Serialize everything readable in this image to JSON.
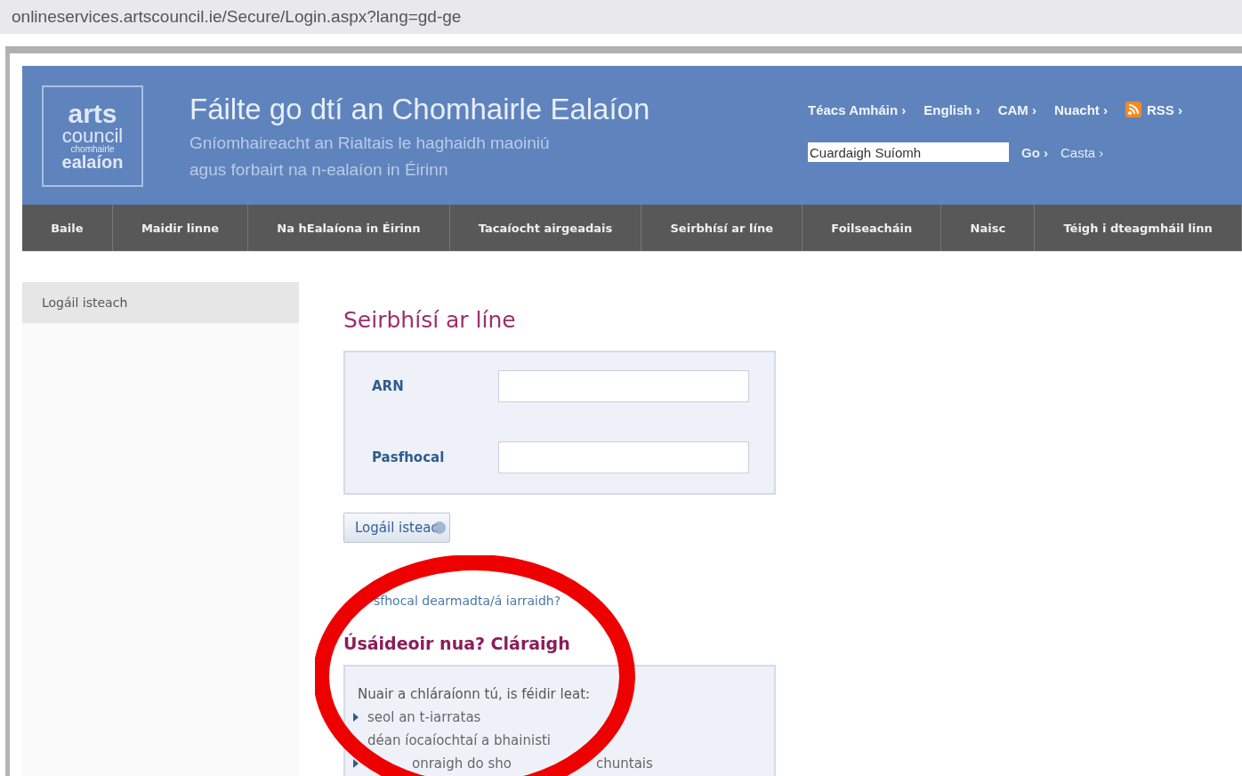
{
  "address_bar": {
    "url": "onlineservices.artscouncil.ie/Secure/Login.aspx?lang=gd-ge"
  },
  "header": {
    "logo": [
      "arts",
      "council",
      "chomhairle",
      "ealaíon"
    ],
    "title": "Fáilte go dtí an Chomhairle Ealaíon",
    "subtitle": [
      "Gníomhaireacht an Rialtais le haghaidh maoiniú",
      "agus forbairt na n-ealaíon in Éirinn"
    ],
    "links": [
      {
        "label": "Téacs Amháin ›",
        "kind": "text"
      },
      {
        "label": "English ›",
        "kind": "text"
      },
      {
        "label": "CAM ›",
        "kind": "text"
      },
      {
        "label": "Nuacht ›",
        "kind": "text"
      },
      {
        "label": "RSS ›",
        "kind": "rss"
      }
    ],
    "search": {
      "value": "Cuardaigh Suíomh",
      "go": "Go ›",
      "advanced": "Casta ›"
    }
  },
  "nav": [
    "Baile",
    "Maidir linne",
    "Na hEalaíona in Éirinn",
    "Tacaíocht airgeadais",
    "Seirbhísí ar líne",
    "Foilseacháin",
    "Naisc",
    "Téigh i dteagmháil linn"
  ],
  "sidebar": {
    "items": [
      {
        "label": "Logáil isteach",
        "selected": true
      }
    ]
  },
  "main": {
    "title": "Seirbhísí ar líne",
    "fields": [
      {
        "label": "ARN"
      },
      {
        "label": "Pasfhocal"
      }
    ],
    "login_button": "Logáil isteac",
    "forgot_link": "sfhocal dearmadta/á iarraidh?",
    "register_heading": "Úsáideoir nua? Cláraigh",
    "register_intro": "Nuair a chláraíonn tú, is féidir leat:",
    "register_items": [
      {
        "parts": [
          "seol an t-iarratas"
        ],
        "bullet": true
      },
      {
        "parts": [
          "déan íocaíochtaí a bhainisti"
        ]
      },
      {
        "parts": [
          "onraigh do sho",
          "chuntais"
        ],
        "bullet": true
      }
    ]
  },
  "annotation": {
    "kind": "ellipse"
  }
}
